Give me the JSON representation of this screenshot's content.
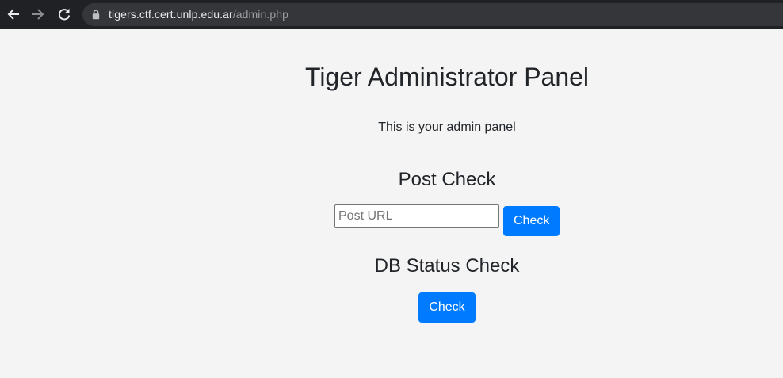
{
  "browser": {
    "url_host": "tigers.ctf.cert.unlp.edu.ar",
    "url_path": "/admin.php"
  },
  "page": {
    "title": "Tiger Administrator Panel",
    "intro": "This is your admin panel"
  },
  "post_check": {
    "heading": "Post Check",
    "input_placeholder": "Post URL",
    "input_value": "",
    "button_label": "Check"
  },
  "db_check": {
    "heading": "DB Status Check",
    "button_label": "Check"
  },
  "colors": {
    "primary": "#007bff",
    "page_background": "#f4f4f4",
    "toolbar_background": "#202124",
    "text": "#212529"
  }
}
